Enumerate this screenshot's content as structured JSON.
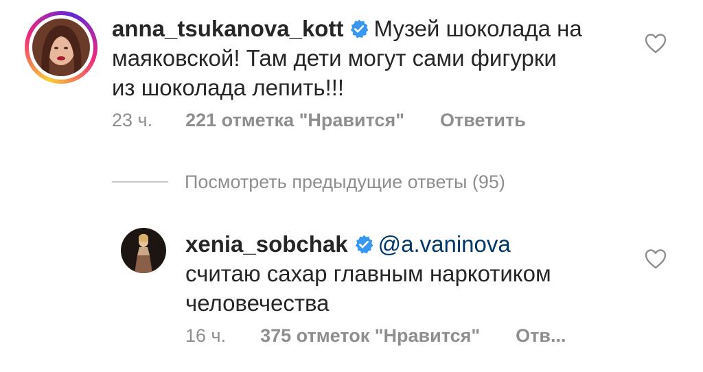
{
  "comments": [
    {
      "username": "anna_tsukanova_kott",
      "verified": true,
      "text_lines": [
        "Музей шоколада на",
        "маяковской! Там дети могут сами фигурки",
        "из шоколада лепить!!!"
      ],
      "time": "23 ч.",
      "likes": "221 отметка \"Нравится\"",
      "reply": "Ответить",
      "avatar_ring": true
    },
    {
      "username": "xenia_sobchak",
      "verified": true,
      "mention": "@a.vaninova",
      "text_lines": [
        "считаю сахар главным наркотиком",
        "человечества"
      ],
      "time": "16 ч.",
      "likes": "375 отметок \"Нравится\"",
      "reply": "Отв..."
    }
  ],
  "view_replies": {
    "label": "Посмотреть предыдущие ответы (95)"
  },
  "colors": {
    "text": "#262626",
    "secondary": "#8e8e8e",
    "verified": "#3897f0",
    "mention": "#00376b",
    "divider": "#c7c7c7"
  },
  "icons": {
    "verified": "verified-badge-icon",
    "like": "heart-outline-icon"
  }
}
